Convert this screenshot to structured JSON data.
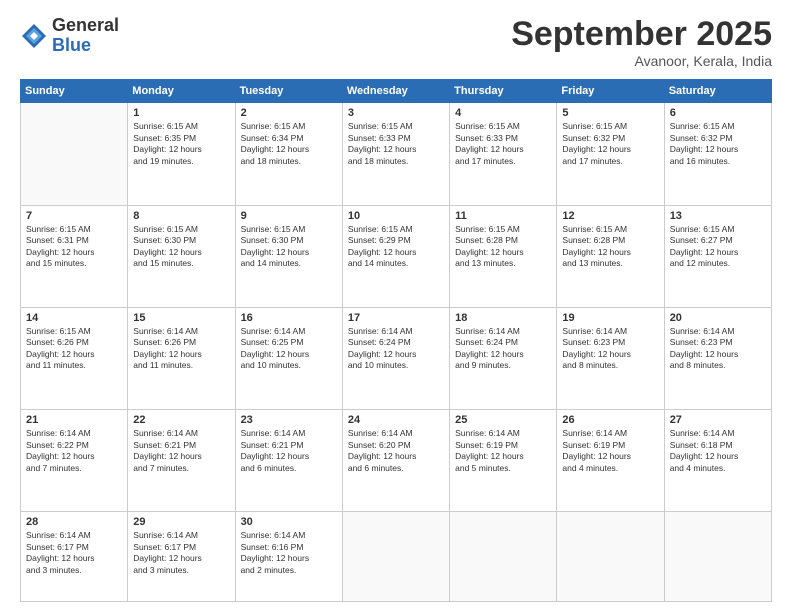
{
  "logo": {
    "general": "General",
    "blue": "Blue"
  },
  "title": "September 2025",
  "subtitle": "Avanoor, Kerala, India",
  "weekdays": [
    "Sunday",
    "Monday",
    "Tuesday",
    "Wednesday",
    "Thursday",
    "Friday",
    "Saturday"
  ],
  "weeks": [
    [
      {
        "day": "",
        "info": ""
      },
      {
        "day": "1",
        "info": "Sunrise: 6:15 AM\nSunset: 6:35 PM\nDaylight: 12 hours\nand 19 minutes."
      },
      {
        "day": "2",
        "info": "Sunrise: 6:15 AM\nSunset: 6:34 PM\nDaylight: 12 hours\nand 18 minutes."
      },
      {
        "day": "3",
        "info": "Sunrise: 6:15 AM\nSunset: 6:33 PM\nDaylight: 12 hours\nand 18 minutes."
      },
      {
        "day": "4",
        "info": "Sunrise: 6:15 AM\nSunset: 6:33 PM\nDaylight: 12 hours\nand 17 minutes."
      },
      {
        "day": "5",
        "info": "Sunrise: 6:15 AM\nSunset: 6:32 PM\nDaylight: 12 hours\nand 17 minutes."
      },
      {
        "day": "6",
        "info": "Sunrise: 6:15 AM\nSunset: 6:32 PM\nDaylight: 12 hours\nand 16 minutes."
      }
    ],
    [
      {
        "day": "7",
        "info": "Sunrise: 6:15 AM\nSunset: 6:31 PM\nDaylight: 12 hours\nand 15 minutes."
      },
      {
        "day": "8",
        "info": "Sunrise: 6:15 AM\nSunset: 6:30 PM\nDaylight: 12 hours\nand 15 minutes."
      },
      {
        "day": "9",
        "info": "Sunrise: 6:15 AM\nSunset: 6:30 PM\nDaylight: 12 hours\nand 14 minutes."
      },
      {
        "day": "10",
        "info": "Sunrise: 6:15 AM\nSunset: 6:29 PM\nDaylight: 12 hours\nand 14 minutes."
      },
      {
        "day": "11",
        "info": "Sunrise: 6:15 AM\nSunset: 6:28 PM\nDaylight: 12 hours\nand 13 minutes."
      },
      {
        "day": "12",
        "info": "Sunrise: 6:15 AM\nSunset: 6:28 PM\nDaylight: 12 hours\nand 13 minutes."
      },
      {
        "day": "13",
        "info": "Sunrise: 6:15 AM\nSunset: 6:27 PM\nDaylight: 12 hours\nand 12 minutes."
      }
    ],
    [
      {
        "day": "14",
        "info": "Sunrise: 6:15 AM\nSunset: 6:26 PM\nDaylight: 12 hours\nand 11 minutes."
      },
      {
        "day": "15",
        "info": "Sunrise: 6:14 AM\nSunset: 6:26 PM\nDaylight: 12 hours\nand 11 minutes."
      },
      {
        "day": "16",
        "info": "Sunrise: 6:14 AM\nSunset: 6:25 PM\nDaylight: 12 hours\nand 10 minutes."
      },
      {
        "day": "17",
        "info": "Sunrise: 6:14 AM\nSunset: 6:24 PM\nDaylight: 12 hours\nand 10 minutes."
      },
      {
        "day": "18",
        "info": "Sunrise: 6:14 AM\nSunset: 6:24 PM\nDaylight: 12 hours\nand 9 minutes."
      },
      {
        "day": "19",
        "info": "Sunrise: 6:14 AM\nSunset: 6:23 PM\nDaylight: 12 hours\nand 8 minutes."
      },
      {
        "day": "20",
        "info": "Sunrise: 6:14 AM\nSunset: 6:23 PM\nDaylight: 12 hours\nand 8 minutes."
      }
    ],
    [
      {
        "day": "21",
        "info": "Sunrise: 6:14 AM\nSunset: 6:22 PM\nDaylight: 12 hours\nand 7 minutes."
      },
      {
        "day": "22",
        "info": "Sunrise: 6:14 AM\nSunset: 6:21 PM\nDaylight: 12 hours\nand 7 minutes."
      },
      {
        "day": "23",
        "info": "Sunrise: 6:14 AM\nSunset: 6:21 PM\nDaylight: 12 hours\nand 6 minutes."
      },
      {
        "day": "24",
        "info": "Sunrise: 6:14 AM\nSunset: 6:20 PM\nDaylight: 12 hours\nand 6 minutes."
      },
      {
        "day": "25",
        "info": "Sunrise: 6:14 AM\nSunset: 6:19 PM\nDaylight: 12 hours\nand 5 minutes."
      },
      {
        "day": "26",
        "info": "Sunrise: 6:14 AM\nSunset: 6:19 PM\nDaylight: 12 hours\nand 4 minutes."
      },
      {
        "day": "27",
        "info": "Sunrise: 6:14 AM\nSunset: 6:18 PM\nDaylight: 12 hours\nand 4 minutes."
      }
    ],
    [
      {
        "day": "28",
        "info": "Sunrise: 6:14 AM\nSunset: 6:17 PM\nDaylight: 12 hours\nand 3 minutes."
      },
      {
        "day": "29",
        "info": "Sunrise: 6:14 AM\nSunset: 6:17 PM\nDaylight: 12 hours\nand 3 minutes."
      },
      {
        "day": "30",
        "info": "Sunrise: 6:14 AM\nSunset: 6:16 PM\nDaylight: 12 hours\nand 2 minutes."
      },
      {
        "day": "",
        "info": ""
      },
      {
        "day": "",
        "info": ""
      },
      {
        "day": "",
        "info": ""
      },
      {
        "day": "",
        "info": ""
      }
    ]
  ]
}
